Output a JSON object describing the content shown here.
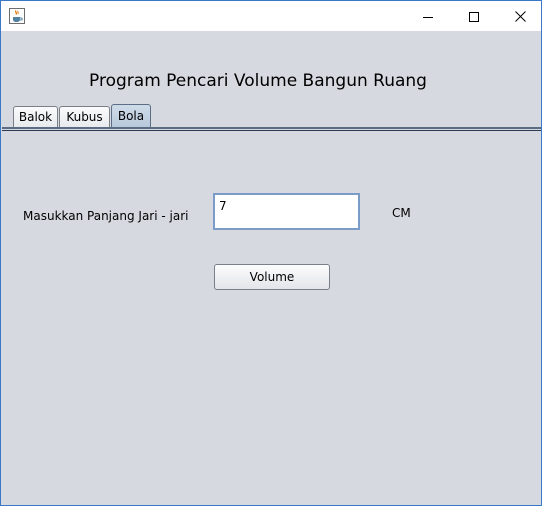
{
  "window": {
    "title": "",
    "icon": "java-cup-icon",
    "controls": [
      "minimize-icon",
      "maximize-icon",
      "close-icon"
    ]
  },
  "heading": "Program Pencari Volume Bangun Ruang",
  "tabs": [
    {
      "label": "Balok",
      "selected": false
    },
    {
      "label": "Kubus",
      "selected": false
    },
    {
      "label": "Bola",
      "selected": true
    }
  ],
  "form": {
    "radius_label": "Masukkan Panjang Jari - jari",
    "radius_value": "7",
    "unit": "CM",
    "button_label": "Volume"
  },
  "colors": {
    "background": "#d6d9e0",
    "window_border": "#3c78c8",
    "selected_tab": "#c5d4e4",
    "input_border": "#7a9cc6"
  }
}
